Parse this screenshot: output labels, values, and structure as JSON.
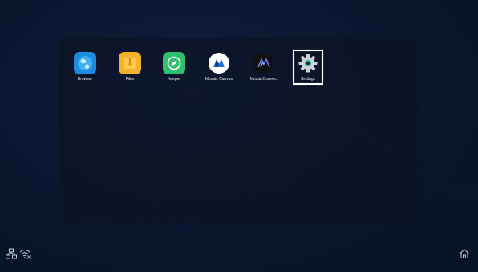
{
  "apps": [
    {
      "label": "Browser",
      "icon": "globe-icon",
      "color": "#1a8de0"
    },
    {
      "label": "Files",
      "icon": "folder-icon",
      "color": "#f5b12e"
    },
    {
      "label": "Keeper",
      "icon": "compass-icon",
      "color": "#2fbf6f"
    },
    {
      "label": "Mosaic Canvas",
      "icon": "mosaic-canvas-icon",
      "color": "#ffffff"
    },
    {
      "label": "MosaicConnect",
      "icon": "mosaic-connect-icon",
      "color": "#111111"
    },
    {
      "label": "Settings",
      "icon": "gear-icon",
      "color": "#cfd3d8",
      "selected": true
    }
  ],
  "status_bar": {
    "network_icon": "wired-network-icon",
    "wifi_icon": "wifi-disconnected-icon",
    "home_icon": "home-icon"
  }
}
